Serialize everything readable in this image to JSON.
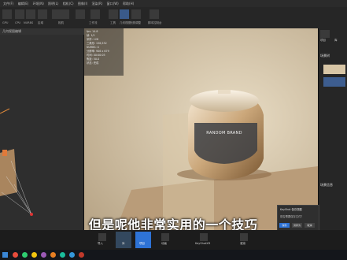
{
  "menubar": {
    "items": [
      "文件(F)",
      "编辑(E)",
      "环境(N)",
      "照明(L)",
      "相机(C)",
      "图像(I)",
      "渲染(R)",
      "窗口(W)",
      "帮助(H)"
    ]
  },
  "toolbar": {
    "labels": [
      "GPU",
      "CPU",
      "NURBS",
      "区域",
      "相机",
      "工作流",
      "工具",
      "几何视图",
      "光照调整",
      "脚本控制台"
    ]
  },
  "leftpanel": {
    "title": "几何视图编辑"
  },
  "viewport": {
    "info": [
      "fps: 14.8",
      "帧: 1/1",
      "采样: 128",
      "三角形: 156,532",
      "NURBS: 0",
      "分辨率: 906 x 679",
      "时间: 00:00:05",
      "焦距: 50.0",
      "状态: 完成"
    ],
    "product_label": "RANDOM BRAND"
  },
  "rightpanel": {
    "tabs": [
      "项目",
      "库"
    ],
    "section": "场景树",
    "section2": "场景信息"
  },
  "subtitle": "但是呢他非常实用的一个技巧",
  "dialog": {
    "title": "KeyShot 保存提醒",
    "body": "是否需要保存文件？",
    "buttons": [
      "保存",
      "另存为",
      "取消"
    ]
  },
  "bottombar": {
    "labels": [
      "导入",
      "库",
      "项目",
      "动画",
      "KeyShotXR",
      "渲染"
    ]
  },
  "colors": {
    "accent": "#2e73d6",
    "viewport_bg": "#c9b99d",
    "panel": "#2a2a2a"
  }
}
